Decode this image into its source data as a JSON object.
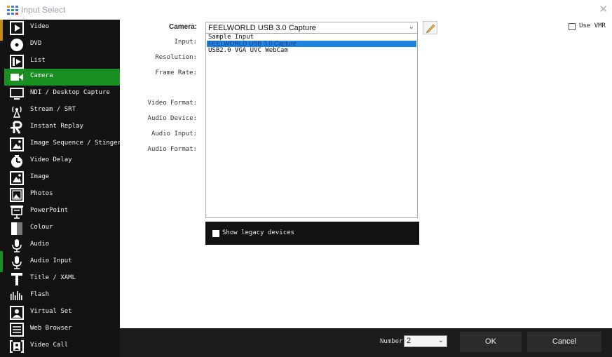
{
  "window": {
    "title": "Input Select",
    "close_glyph": "✕"
  },
  "sidebar": {
    "items": [
      {
        "label": "Video",
        "icon": "video-icon"
      },
      {
        "label": "DVD",
        "icon": "disc-icon"
      },
      {
        "label": "List",
        "icon": "list-icon"
      },
      {
        "label": "Camera",
        "icon": "camera-icon",
        "active": true
      },
      {
        "label": "NDI / Desktop Capture",
        "icon": "monitor-icon"
      },
      {
        "label": "Stream / SRT",
        "icon": "antenna-icon"
      },
      {
        "label": "Instant Replay",
        "icon": "replay-icon"
      },
      {
        "label": "Image Sequence / Stinger",
        "icon": "image-sequence-icon"
      },
      {
        "label": "Video Delay",
        "icon": "clock-icon"
      },
      {
        "label": "Image",
        "icon": "image-icon"
      },
      {
        "label": "Photos",
        "icon": "photos-icon"
      },
      {
        "label": "PowerPoint",
        "icon": "presentation-icon"
      },
      {
        "label": "Colour",
        "icon": "colour-icon"
      },
      {
        "label": "Audio",
        "icon": "microphone-icon"
      },
      {
        "label": "Audio Input",
        "icon": "microphone-icon"
      },
      {
        "label": "Title / XAML",
        "icon": "title-icon"
      },
      {
        "label": "Flash",
        "icon": "flash-icon"
      },
      {
        "label": "Virtual Set",
        "icon": "person-icon"
      },
      {
        "label": "Web Browser",
        "icon": "browser-icon"
      },
      {
        "label": "Video Call",
        "icon": "video-call-icon"
      }
    ]
  },
  "form": {
    "camera_label": "Camera:",
    "camera_value": "FEELWORLD USB 3.0 Capture",
    "input_label": "Input:",
    "resolution_label": "Resolution:",
    "frame_rate_label": "Frame Rate:",
    "video_format_label": "Video Format:",
    "audio_device_label": "Audio Device:",
    "audio_input_label": "Audio Input:",
    "audio_format_label": "Audio Format:",
    "camera_options": [
      {
        "label": "Sample Input"
      },
      {
        "label": "FEELWORLD USB 3.0 Capture",
        "selected": true
      },
      {
        "label": "USB2.0 VGA UVC WebCam"
      }
    ],
    "legacy_label": "Show legacy devices",
    "use_vmr_label": "Use VMR"
  },
  "footer": {
    "number_label": "Number",
    "number_value": "2",
    "ok_label": "OK",
    "cancel_label": "Cancel"
  },
  "colors": {
    "accent": "#1a8f22",
    "sidebar_bg": "#131313",
    "selection": "#1e86e0",
    "footer_bg": "#1c1c1c"
  }
}
